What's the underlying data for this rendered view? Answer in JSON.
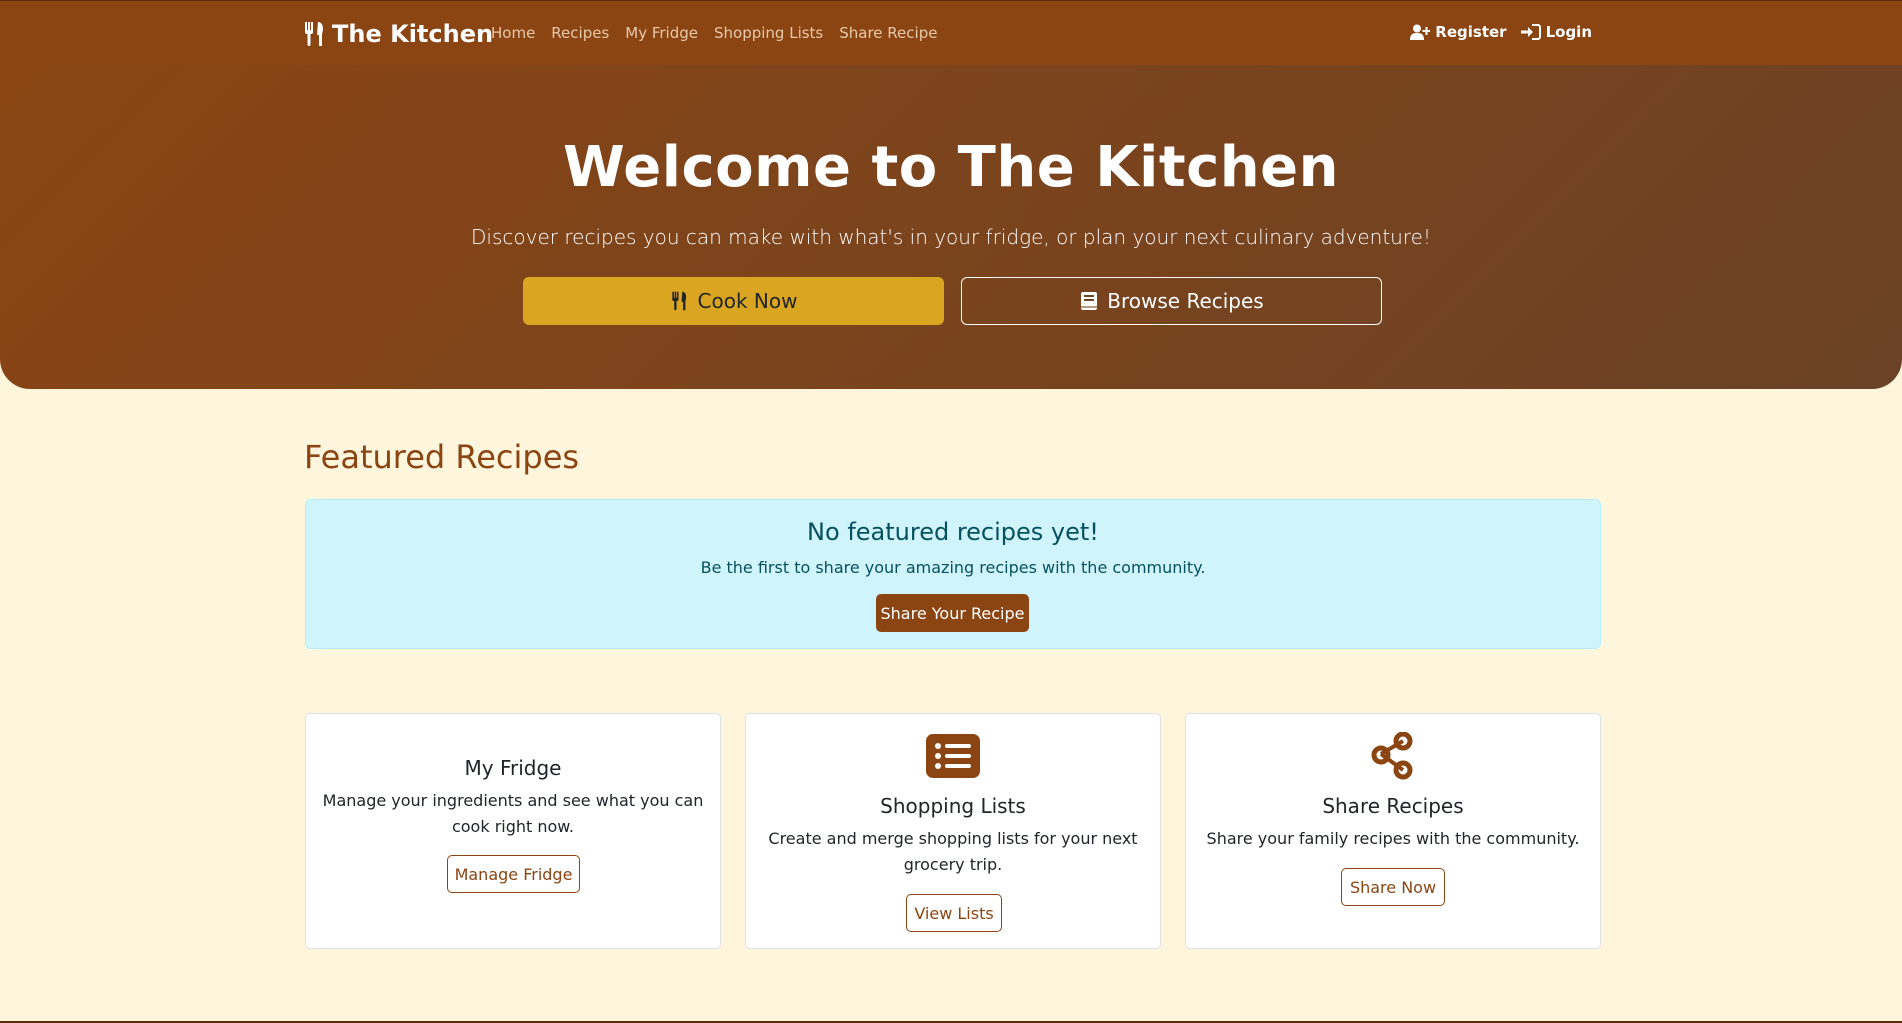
{
  "nav": {
    "brand": "The Kitchen",
    "links": [
      "Home",
      "Recipes",
      "My Fridge",
      "Shopping Lists",
      "Share Recipe"
    ],
    "register": "Register",
    "login": "Login"
  },
  "hero": {
    "title": "Welcome to The Kitchen",
    "subtitle": "Discover recipes you can make with what's in your fridge, or plan your next culinary adventure!",
    "cook_button": "Cook Now",
    "browse_button": "Browse Recipes"
  },
  "featured": {
    "title": "Featured Recipes",
    "empty_title": "No featured recipes yet!",
    "empty_text": "Be the first to share your amazing recipes with the community.",
    "share_button": "Share Your Recipe"
  },
  "cards": {
    "fridge": {
      "title": "My Fridge",
      "text": "Manage your ingredients and see what you can cook right now.",
      "button": "Manage Fridge"
    },
    "lists": {
      "title": "Shopping Lists",
      "text": "Create and merge shopping lists for your next grocery trip.",
      "button": "View Lists"
    },
    "share": {
      "title": "Share Recipes",
      "text": "Share your family recipes with the community.",
      "button": "Share Now"
    }
  },
  "colors": {
    "primary": "#8b4513",
    "accent": "#daa520",
    "background": "#fef6dc",
    "alert_bg": "#cff4fc"
  }
}
